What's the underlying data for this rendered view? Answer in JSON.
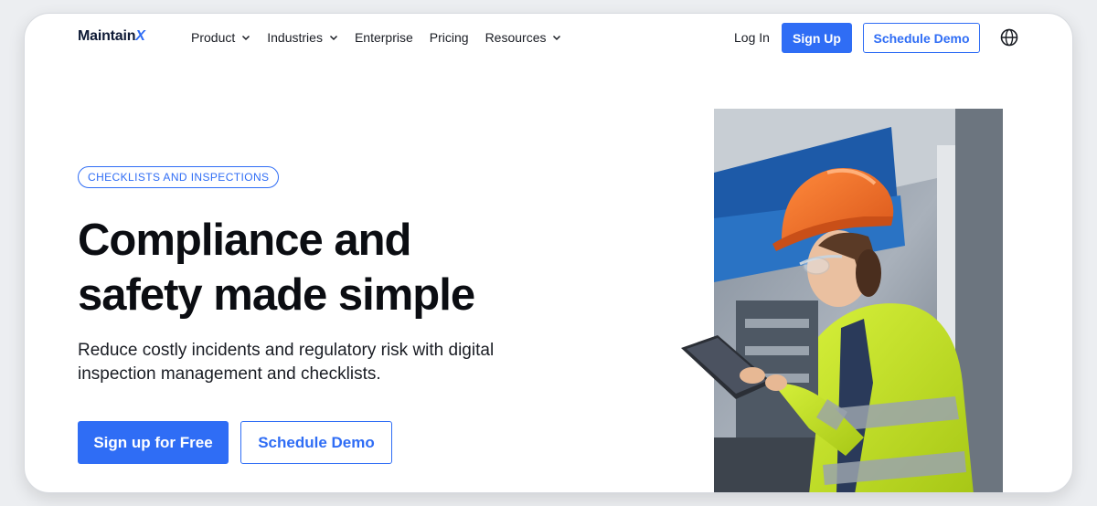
{
  "nav": {
    "logo_main": "Maintain",
    "logo_accent": "X",
    "menu": [
      {
        "label": "Product",
        "dropdown": true
      },
      {
        "label": "Industries",
        "dropdown": true
      },
      {
        "label": "Enterprise",
        "dropdown": false
      },
      {
        "label": "Pricing",
        "dropdown": false
      },
      {
        "label": "Resources",
        "dropdown": true
      }
    ],
    "login": "Log In",
    "signup": "Sign Up",
    "schedule_demo": "Schedule Demo",
    "language_icon": "globe-icon"
  },
  "hero": {
    "tag": "CHECKLISTS AND INSPECTIONS",
    "headline_line1": "Compliance and",
    "headline_line2": "safety made simple",
    "subtext_line1": "Reduce costly incidents and regulatory risk with digital",
    "subtext_line2": "inspection management and checklists.",
    "cta_primary": "Sign up for Free",
    "cta_secondary": "Schedule Demo"
  },
  "colors": {
    "accent": "#2f6df5",
    "text": "#0b0d12",
    "hard_hat": "#ee6a22",
    "hi_vis": "#c8ec1e"
  }
}
